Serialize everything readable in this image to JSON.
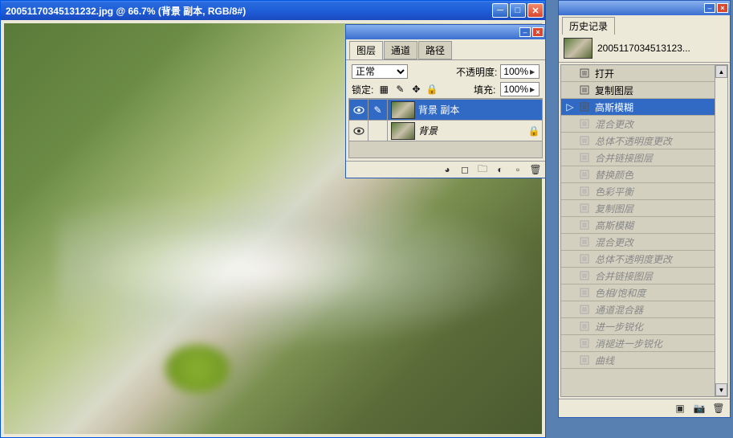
{
  "doc_window": {
    "title": "20051170345131232.jpg @ 66.7% (背景 副本, RGB/8#)"
  },
  "layers_panel": {
    "tabs": [
      "图层",
      "通道",
      "路径"
    ],
    "active_tab": 0,
    "blend_mode_label": "正常",
    "opacity_label": "不透明度:",
    "opacity_value": "100%",
    "lock_label": "锁定:",
    "fill_label": "填充:",
    "fill_value": "100%",
    "layers": [
      {
        "name": "背景 副本",
        "visible": true,
        "active": true,
        "locked": false
      },
      {
        "name": "背景",
        "visible": true,
        "active": false,
        "locked": true
      }
    ]
  },
  "history_panel": {
    "title": "历史记录",
    "snapshot": "2005117034513123...",
    "items": [
      {
        "label": "打开",
        "state": "past"
      },
      {
        "label": "复制图层",
        "state": "past"
      },
      {
        "label": "高斯模糊",
        "state": "current"
      },
      {
        "label": "混合更改",
        "state": "future"
      },
      {
        "label": "总体不透明度更改",
        "state": "future"
      },
      {
        "label": "合并链接图层",
        "state": "future"
      },
      {
        "label": "替换颜色",
        "state": "future"
      },
      {
        "label": "色彩平衡",
        "state": "future"
      },
      {
        "label": "复制图层",
        "state": "future"
      },
      {
        "label": "高斯模糊",
        "state": "future"
      },
      {
        "label": "混合更改",
        "state": "future"
      },
      {
        "label": "总体不透明度更改",
        "state": "future"
      },
      {
        "label": "合并链接图层",
        "state": "future"
      },
      {
        "label": "色相/饱和度",
        "state": "future"
      },
      {
        "label": "通道混合器",
        "state": "future"
      },
      {
        "label": "进一步锐化",
        "state": "future"
      },
      {
        "label": "消褪进一步锐化",
        "state": "future"
      },
      {
        "label": "曲线",
        "state": "future"
      }
    ]
  }
}
